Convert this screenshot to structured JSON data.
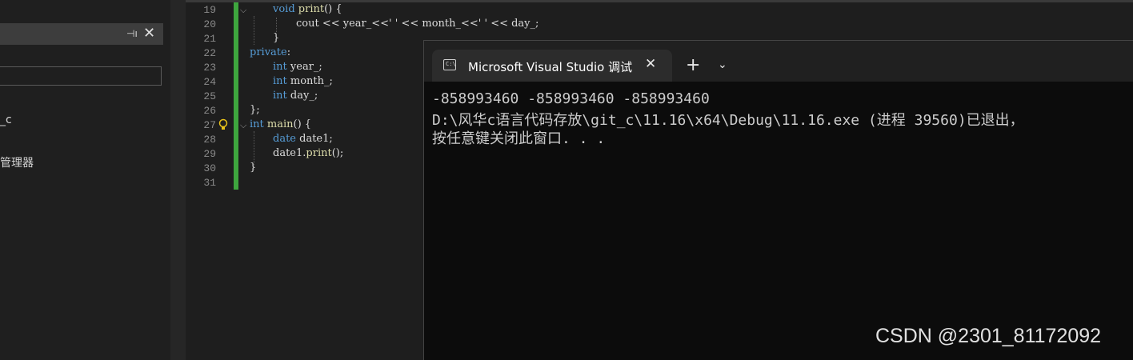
{
  "left_panel": {
    "pin_icon": "pin-icon",
    "close_icon": "close-icon",
    "tree_items": [
      "_c",
      "管理器"
    ]
  },
  "editor": {
    "lines": [
      {
        "n": "19"
      },
      {
        "n": "20"
      },
      {
        "n": "21"
      },
      {
        "n": "22"
      },
      {
        "n": "23"
      },
      {
        "n": "24"
      },
      {
        "n": "25"
      },
      {
        "n": "26"
      },
      {
        "n": "27"
      },
      {
        "n": "28"
      },
      {
        "n": "29"
      },
      {
        "n": "30"
      },
      {
        "n": "31"
      }
    ],
    "code": {
      "l19_kw": "void",
      "l19_fn": "print",
      "l19_rest": "() {",
      "l20": "cout << year_<<' ' << month_<<' ' << day_;",
      "l21": "}",
      "l22_kw": "private",
      "l22_rest": ":",
      "l23_kw": "int",
      "l23_rest": "year_;",
      "l24_kw": "int",
      "l24_rest": "month_;",
      "l25_kw": "int",
      "l25_rest": "day_;",
      "l26": "};",
      "l27_kw": "int",
      "l27_fn": "main",
      "l27_rest": "() {",
      "l28_kw": "date",
      "l28_rest": "date1;",
      "l29_a": "date1.",
      "l29_fn": "print",
      "l29_rest": "();",
      "l30": "}"
    },
    "colors": {
      "keyword": "#569cd6",
      "function": "#dcdcaa",
      "change_bar": "#3ea63e"
    }
  },
  "terminal": {
    "tab_title": "Microsoft Visual Studio 调试控制台",
    "tab_icon": "cmd-icon",
    "cmd_icon_text": "C:\\",
    "close_glyph": "✕",
    "new_tab_glyph": "+",
    "menu_glyph": "⌄",
    "output": [
      "-858993460 -858993460 -858993460",
      "D:\\风华c语言代码存放\\git_c\\11.16\\x64\\Debug\\11.16.exe (进程 39560)已退出，",
      "按任意键关闭此窗口. . ."
    ]
  },
  "watermark": "CSDN @2301_81172092"
}
